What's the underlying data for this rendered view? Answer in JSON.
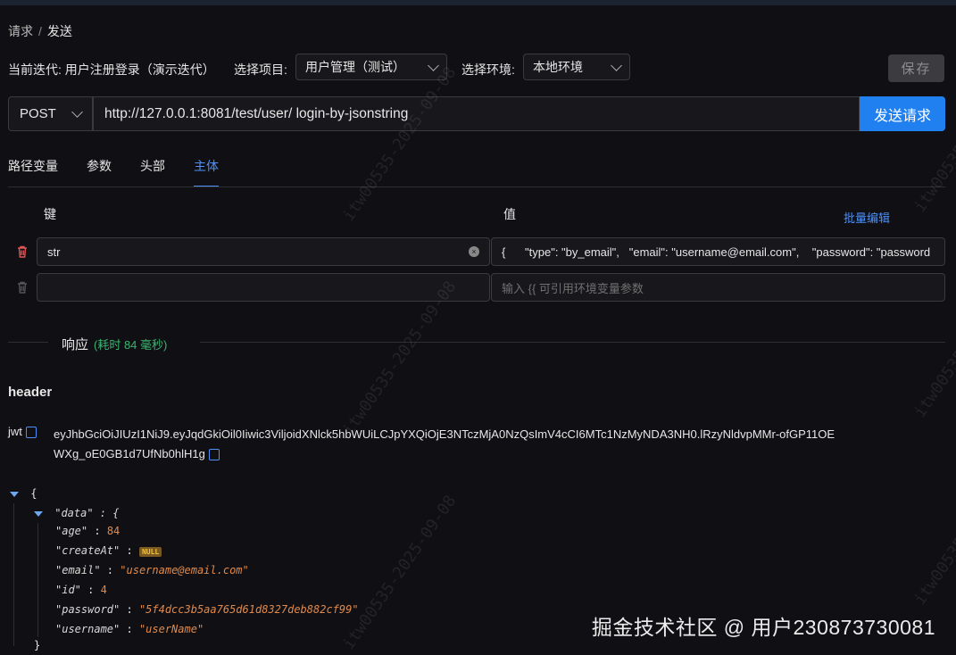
{
  "breadcrumb": {
    "parent": "请求",
    "separator": "/",
    "current": "发送"
  },
  "context": {
    "iteration_label": "当前迭代: 用户注册登录（演示迭代）",
    "project_label": "选择项目:",
    "project_value": "用户管理（测试）",
    "env_label": "选择环境:",
    "env_value": "本地环境",
    "save_label": "保存"
  },
  "request": {
    "method": "POST",
    "url": "http://127.0.0.1:8081/test/user/ login-by-jsonstring",
    "send_label": "发送请求"
  },
  "tabs": [
    {
      "label": "路径变量"
    },
    {
      "label": "参数"
    },
    {
      "label": "头部"
    },
    {
      "label": "主体"
    }
  ],
  "active_tab": "主体",
  "body_table": {
    "key_header": "键",
    "value_header": "值",
    "batch_edit": "批量编辑",
    "rows": [
      {
        "key": "str",
        "value": "{      \"type\": \"by_email\",   \"email\": \"username@email.com\",    \"password\": \"password"
      },
      {
        "key": "",
        "value_placeholder": "输入 {{ 可引用环境变量参数"
      }
    ]
  },
  "response": {
    "title": "响应",
    "time": "(耗时 84 毫秒)",
    "header_title": "header",
    "jwt_key": "jwt",
    "jwt_value": "eyJhbGciOiJIUzI1NiJ9.eyJqdGkiOil0Iiwic3ViljoidXNlck5hbWUiLCJpYXQiOjE3NTczMjA0NzQsImV4cCI6MTc1NzMyNDA3NH0.lRzyNldvpMMr-ofGP11OEWXg_oE0GB1d7UfNb0hlH1g",
    "json": {
      "open": "{",
      "data_key": "\"data\" : {",
      "fields": [
        {
          "key": "\"age\"",
          "sep": " : ",
          "value": "84",
          "kind": "num"
        },
        {
          "key": "\"createAt\"",
          "sep": " : ",
          "value": "NULL",
          "kind": "null"
        },
        {
          "key": "\"email\"",
          "sep": " : ",
          "value": "\"username@email.com\"",
          "kind": "str"
        },
        {
          "key": "\"id\"",
          "sep": " : ",
          "value": "4",
          "kind": "num"
        },
        {
          "key": "\"password\"",
          "sep": " : ",
          "value": "\"5f4dcc3b5aa765d61d8327deb882cf99\"",
          "kind": "str"
        },
        {
          "key": "\"username\"",
          "sep": " : ",
          "value": "\"userName\"",
          "kind": "str"
        }
      ],
      "close_data": "}"
    }
  },
  "watermark": {
    "corner": "掘金技术社区 @ 用户230873730081",
    "diagonal": "itw00535-2025-09-08"
  },
  "colors": {
    "accent": "#2080f0",
    "danger": "#e05555",
    "success": "#3cb371",
    "value": "#e0894a"
  }
}
